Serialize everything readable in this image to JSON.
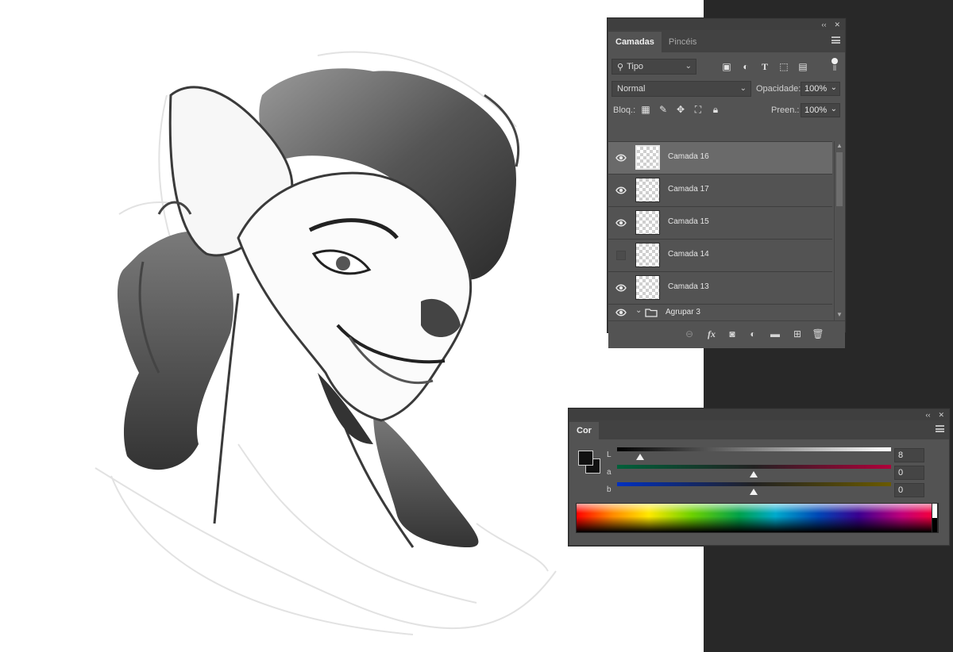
{
  "layers_panel": {
    "tabs": [
      {
        "label": "Camadas",
        "active": true
      },
      {
        "label": "Pincéis",
        "active": false
      }
    ],
    "filter": {
      "label": "Tipo"
    },
    "blend_mode": "Normal",
    "opacity": {
      "label": "Opacidade:",
      "value": "100%"
    },
    "lock_label": "Bloq.:",
    "fill": {
      "label": "Preen.:",
      "value": "100%"
    },
    "layers": [
      {
        "name": "Camada 16",
        "visible": true,
        "selected": true
      },
      {
        "name": "Camada 17",
        "visible": true,
        "selected": false
      },
      {
        "name": "Camada 15",
        "visible": true,
        "selected": false
      },
      {
        "name": "Camada 14",
        "visible": false,
        "selected": false
      },
      {
        "name": "Camada 13",
        "visible": true,
        "selected": false
      },
      {
        "name": "Agrupar 3",
        "visible": true,
        "selected": false,
        "group": true
      }
    ]
  },
  "color_panel": {
    "tab": "Cor",
    "sliders": [
      {
        "label": "L",
        "value": "8",
        "fraction": 0.08
      },
      {
        "label": "a",
        "value": "0",
        "fraction": 0.5
      },
      {
        "label": "b",
        "value": "0",
        "fraction": 0.5
      }
    ],
    "foreground_color": "#111111",
    "background_color": "#111111"
  },
  "colors": {
    "panel_bg": "#535353",
    "dark_bg": "#282828",
    "selected_layer": "#6a6a6a"
  }
}
